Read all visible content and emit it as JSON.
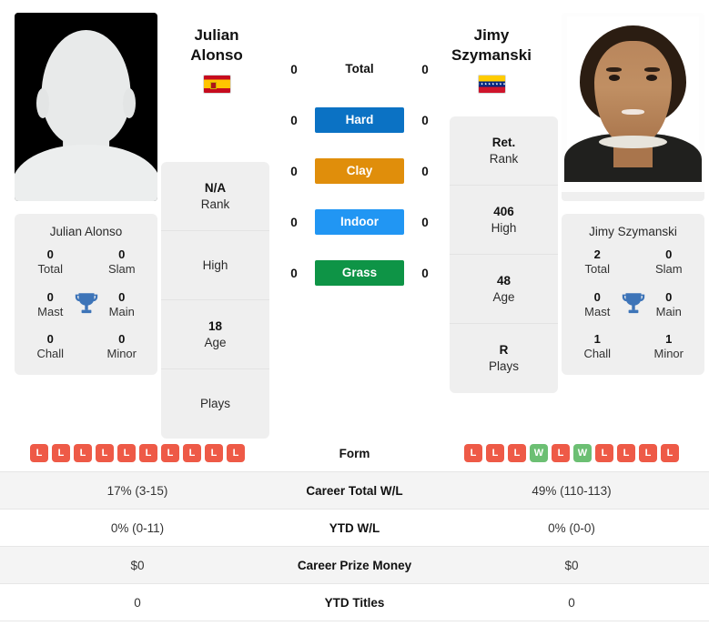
{
  "players": {
    "left": {
      "name_line1": "Julian",
      "name_line2": "Alonso",
      "full_name": "Julian Alonso",
      "flag": "es-flag-icon",
      "flag_country": "Spain",
      "photo": "placeholder-silhouette",
      "rank": "N/A",
      "rank_label": "Rank",
      "high": "",
      "high_label": "High",
      "age": "18",
      "age_label": "Age",
      "plays": "",
      "plays_label": "Plays",
      "titles": {
        "total": "0",
        "total_label": "Total",
        "slam": "0",
        "slam_label": "Slam",
        "mast": "0",
        "mast_label": "Mast",
        "main": "0",
        "main_label": "Main",
        "chall": "0",
        "chall_label": "Chall",
        "minor": "0",
        "minor_label": "Minor"
      },
      "form": [
        "L",
        "L",
        "L",
        "L",
        "L",
        "L",
        "L",
        "L",
        "L",
        "L"
      ],
      "career_total_wl": "17% (3-15)",
      "ytd_wl": "0% (0-11)",
      "career_prize_money": "$0",
      "ytd_titles": "0"
    },
    "right": {
      "name_line1": "Jimy",
      "name_line2": "Szymanski",
      "full_name": "Jimy Szymanski",
      "flag": "ve-flag-icon",
      "flag_country": "Venezuela",
      "photo": "player-headshot",
      "rank": "Ret.",
      "rank_label": "Rank",
      "high": "406",
      "high_label": "High",
      "age": "48",
      "age_label": "Age",
      "plays": "R",
      "plays_label": "Plays",
      "titles": {
        "total": "2",
        "total_label": "Total",
        "slam": "0",
        "slam_label": "Slam",
        "mast": "0",
        "mast_label": "Mast",
        "main": "0",
        "main_label": "Main",
        "chall": "1",
        "chall_label": "Chall",
        "minor": "1",
        "minor_label": "Minor"
      },
      "form": [
        "L",
        "L",
        "L",
        "W",
        "L",
        "W",
        "L",
        "L",
        "L",
        "L"
      ],
      "career_total_wl": "49% (110-113)",
      "ytd_wl": "0% (0-0)",
      "career_prize_money": "$0",
      "ytd_titles": "0"
    }
  },
  "surfaces": [
    {
      "label": "Total",
      "left": "0",
      "right": "0",
      "color": "none",
      "style": "plain"
    },
    {
      "label": "Hard",
      "left": "0",
      "right": "0",
      "color": "#0b72c4",
      "style": "badge"
    },
    {
      "label": "Clay",
      "left": "0",
      "right": "0",
      "color": "#e08e0b",
      "style": "badge"
    },
    {
      "label": "Indoor",
      "left": "0",
      "right": "0",
      "color": "#2196f3",
      "style": "badge"
    },
    {
      "label": "Grass",
      "left": "0",
      "right": "0",
      "color": "#0e9446",
      "style": "badge"
    }
  ],
  "table": {
    "rows": [
      {
        "label": "Form",
        "type": "form"
      },
      {
        "label": "Career Total W/L",
        "type": "text",
        "key": "career_total_wl"
      },
      {
        "label": "YTD W/L",
        "type": "text",
        "key": "ytd_wl"
      },
      {
        "label": "Career Prize Money",
        "type": "text",
        "key": "career_prize_money"
      },
      {
        "label": "YTD Titles",
        "type": "text",
        "key": "ytd_titles"
      }
    ]
  },
  "colors": {
    "card_bg": "#efefef",
    "win": "#6cbf73",
    "loss": "#ee5a47",
    "trophy": "#3d74b8",
    "row_shade": "#f4f4f4"
  }
}
